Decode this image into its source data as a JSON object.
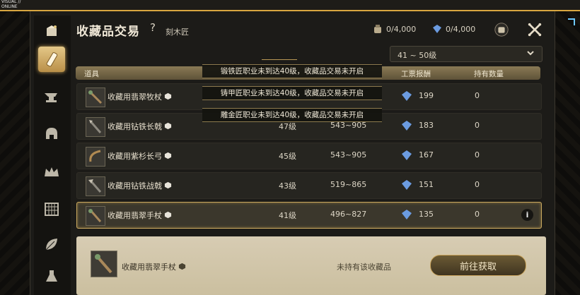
{
  "watermark": {
    "line1": "VISUAL //",
    "line2": "ONLINE"
  },
  "header": {
    "title": "收藏品交易",
    "help": "?",
    "subtitle": "刻木匠",
    "currency1": "0/4,000",
    "currency2": "0/4,000"
  },
  "dropdown": {
    "value": "41 ~ 50级"
  },
  "table": {
    "headers": {
      "item": "道具",
      "reward": "工票报酬",
      "qty": "持有数量"
    },
    "rows": [
      {
        "name": "收藏用翡翠牧杖",
        "level": "",
        "range": "",
        "reward": "199",
        "qty": "0"
      },
      {
        "name": "收藏用钻铁长戟",
        "level": "47级",
        "range": "543~905",
        "reward": "183",
        "qty": "0"
      },
      {
        "name": "收藏用紫杉长弓",
        "level": "45级",
        "range": "543~905",
        "reward": "167",
        "qty": "0"
      },
      {
        "name": "收藏用钻铁战戟",
        "level": "43级",
        "range": "519~865",
        "reward": "151",
        "qty": "0"
      },
      {
        "name": "收藏用翡翠手杖",
        "level": "41级",
        "range": "496~827",
        "reward": "135",
        "qty": "0"
      }
    ]
  },
  "banners": [
    "锻铁匠职业未到达40级，收藏品交易未开启",
    "铸甲匠职业未到达40级，收藏品交易未开启",
    "雕金匠职业未到达40级，收藏品交易未开启"
  ],
  "bottom": {
    "name": "收藏用翡翠手杖",
    "status": "未持有该收藏品",
    "button": "前往获取"
  },
  "colors": {
    "accent": "#c9a95f",
    "panel": "#1c1b18",
    "gem": "#6b9be0"
  },
  "sidebar": {
    "icons": [
      "woodworking-icon",
      "anvil-icon",
      "helmet-icon",
      "crown-icon",
      "loom-icon",
      "leaf-icon",
      "flask-icon"
    ]
  }
}
